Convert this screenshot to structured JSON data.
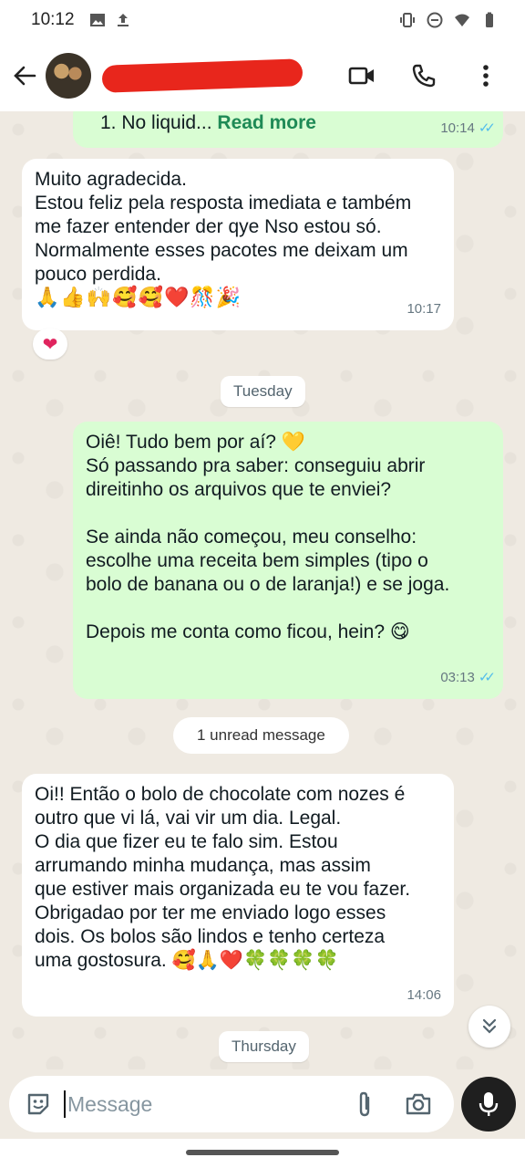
{
  "status_bar": {
    "time": "10:12"
  },
  "header": {
    "back_icon": "back-arrow-icon",
    "actions": [
      "video-call-icon",
      "voice-call-icon",
      "more-vert-icon"
    ]
  },
  "messages": {
    "m0": {
      "text": "1.  No liquid... ",
      "read_more": "Read more",
      "time": "10:14"
    },
    "m1": {
      "lines": [
        "Muito agradecida.",
        "Estou feliz pela resposta imediata e também",
        "me fazer entender der qye Nso estou só.",
        "Normalmente esses pacotes me deixam um",
        "pouco perdida."
      ],
      "emojis": "🙏👍🙌🥰🥰❤️🎊🎉",
      "time": "10:17",
      "reaction": "❤"
    },
    "date1": "Tuesday",
    "m2": {
      "lines": [
        "Oiê! Tudo bem por aí? 💛",
        "Só passando pra saber: conseguiu abrir",
        "direitinho os arquivos que te enviei?",
        "",
        "Se ainda não começou, meu conselho:",
        "escolhe uma receita bem simples (tipo o",
        "bolo de banana ou o de laranja!) e se joga.",
        "",
        "Depois me conta como ficou, hein? 😋"
      ],
      "time": "03:13"
    },
    "unread": "1 unread message",
    "m3": {
      "lines": [
        "Oi!! Então o bolo de chocolate com nozes é",
        "outro que vi lá, vai vir um dia. Legal.",
        "O dia que fizer eu te falo sim. Estou",
        "arrumando minha mudança, mas assim",
        "que estiver mais organizada eu te vou fazer.",
        "Obrigadao por ter me enviado logo esses",
        "dois. Os bolos são lindos e tenho certeza",
        "uma gostosura. 🥰🙏❤️🍀🍀🍀🍀"
      ],
      "time": "14:06"
    },
    "date2": "Thursday"
  },
  "input": {
    "placeholder": "Message"
  },
  "colors": {
    "incoming": "#ffffff",
    "outgoing": "#d9fdd3",
    "chat_bg": "#efeae2",
    "read_ticks": "#53bdeb",
    "redaction": "#e8261c"
  }
}
